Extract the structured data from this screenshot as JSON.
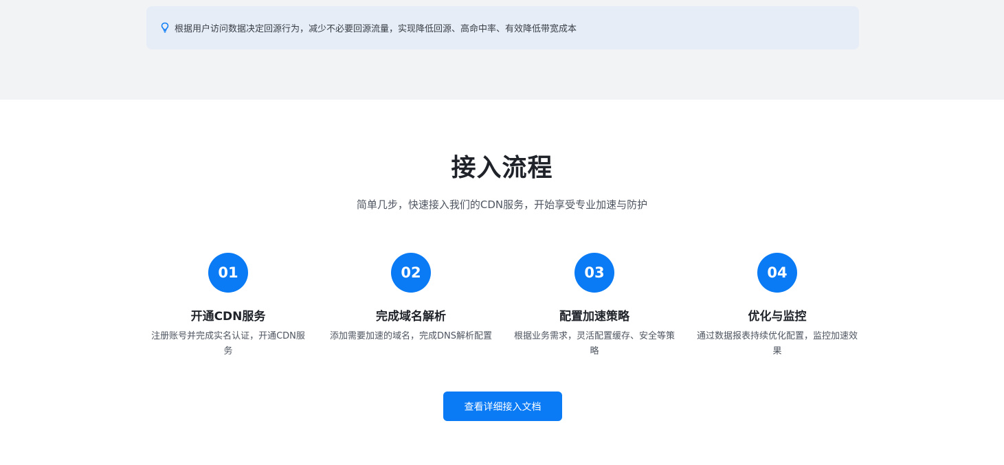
{
  "tip": {
    "icon": "lightbulb-icon",
    "text": "根据用户访问数据决定回源行为，减少不必要回源流量，实现降低回源、高命中率、有效降低带宽成本"
  },
  "process": {
    "title": "接入流程",
    "subtitle": "简单几步，快速接入我们的CDN服务，开始享受专业加速与防护",
    "steps": [
      {
        "number": "01",
        "title": "开通CDN服务",
        "description": "注册账号并完成实名认证，开通CDN服务"
      },
      {
        "number": "02",
        "title": "完成域名解析",
        "description": "添加需要加速的域名，完成DNS解析配置"
      },
      {
        "number": "03",
        "title": "配置加速策略",
        "description": "根据业务需求，灵活配置缓存、安全等策略"
      },
      {
        "number": "04",
        "title": "优化与监控",
        "description": "通过数据报表持续优化配置，监控加速效果"
      }
    ],
    "button_label": "查看详细接入文档"
  },
  "colors": {
    "accent": "#0a7bf5",
    "top_band": "#f2f3f5",
    "tip_background": "#e6edf7"
  }
}
